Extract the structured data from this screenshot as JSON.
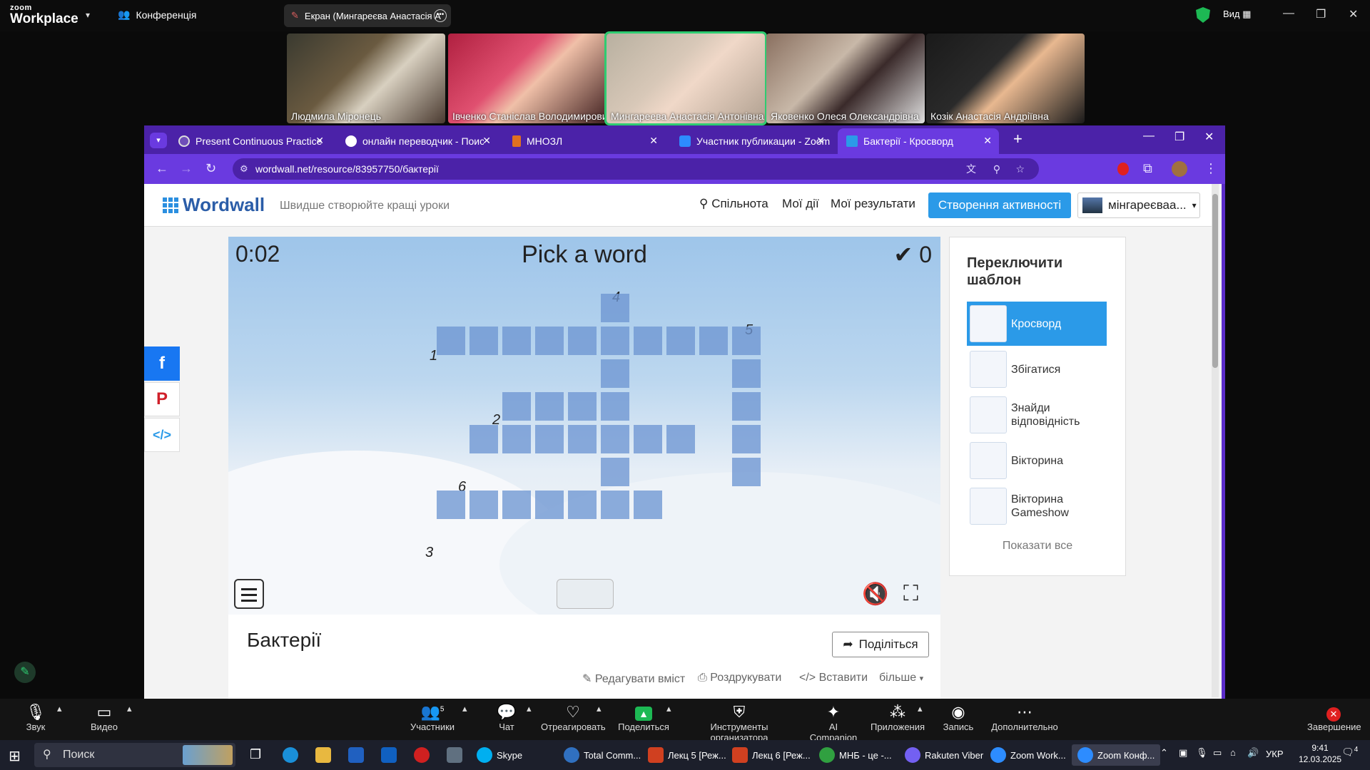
{
  "zoom": {
    "logo_small": "zoom",
    "logo_big": "Workplace",
    "conference": "Конференція",
    "share_label": "Екран (Мингареєва Анастасія А",
    "view": "Вид",
    "participants": [
      {
        "name": "Людмила Міронець"
      },
      {
        "name": "Івченко Станіслав Володимирович"
      },
      {
        "name": "Мингареева Анастасія Антонівна"
      },
      {
        "name": "Яковенко Олеся Олександрівна"
      },
      {
        "name": "Козік Анастасія Андріївна"
      }
    ],
    "toolbar": {
      "audio": "Звук",
      "video": "Видео",
      "participants": "Участники",
      "participants_count": "5",
      "chat": "Чат",
      "react": "Отреагировать",
      "share": "Поделиться",
      "host_tools": "Инструменты организатора",
      "ai": "AI Companion",
      "apps": "Приложения",
      "record": "Запись",
      "more": "Дополнительно",
      "end": "Завершение"
    }
  },
  "browser": {
    "tabs": [
      {
        "label": "Present Continuous Practice"
      },
      {
        "label": "онлайн переводчик - Поиск в"
      },
      {
        "label": "МНОЗЛ"
      },
      {
        "label": "Участник публикации - Zoom"
      },
      {
        "label": "Бактерії - Кросворд"
      }
    ],
    "url": "wordwall.net/resource/83957750/бактерії"
  },
  "wordwall": {
    "logo": "Wordwall",
    "tagline": "Швидше створюйте кращі уроки",
    "nav": {
      "community": "Спільнота",
      "my_activities": "Мої дії",
      "my_results": "Мої результати",
      "create": "Створення активності",
      "user": "мінгареєваа..."
    },
    "game": {
      "timer": "0:02",
      "title": "Pick a word",
      "score": "0",
      "clue_numbers": [
        "1",
        "2",
        "3",
        "4",
        "5",
        "6"
      ]
    },
    "activity": {
      "title": "Бактерії",
      "share": "Поділіться",
      "edit": "Редагувати вміст",
      "print": "Роздрукувати",
      "embed": "Вставити",
      "more": "більше"
    },
    "template_panel": {
      "heading": "Переключити шаблон",
      "items": [
        {
          "label": "Кросворд"
        },
        {
          "label": "Збігатися"
        },
        {
          "label": "Знайди відповідність"
        },
        {
          "label": "Вікторина"
        },
        {
          "label": "Вікторина Gameshow"
        }
      ],
      "show_all": "Показати все"
    }
  },
  "taskbar": {
    "search": "Поиск",
    "apps": [
      {
        "label": "Skype"
      },
      {
        "label": "Total Comm..."
      },
      {
        "label": "Лекц 5 [Реж..."
      },
      {
        "label": "Лекц 6 [Реж..."
      },
      {
        "label": "МНБ - це -..."
      },
      {
        "label": "Rakuten Viber"
      },
      {
        "label": "Zoom Work..."
      },
      {
        "label": "Zoom Конф..."
      }
    ],
    "lang": "УКР",
    "time": "9:41",
    "date": "12.03.2025",
    "notif": "4"
  },
  "colors": {
    "browser_chrome": "#5b2cc9",
    "ww_blue": "#2b9ae8",
    "zoom_green": "#1db954",
    "cell": "#6e96d2"
  }
}
